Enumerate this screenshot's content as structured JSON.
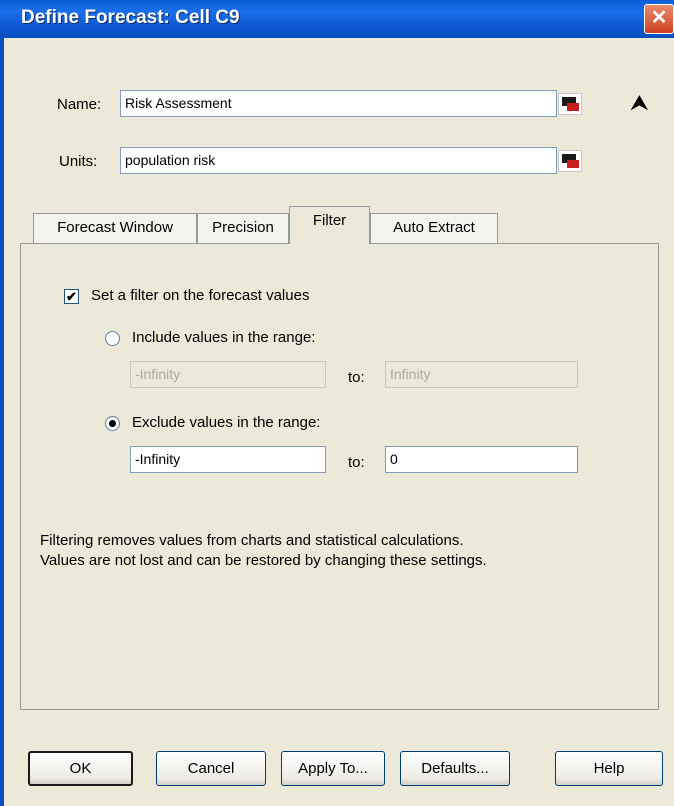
{
  "window": {
    "title": "Define Forecast: Cell C9",
    "close": "✕"
  },
  "name": {
    "label": "Name:",
    "value": "Risk Assessment"
  },
  "units": {
    "label": "Units:",
    "value": "population risk"
  },
  "collapse_icon": "⮝",
  "tabs": [
    {
      "label": "Forecast Window",
      "active": false
    },
    {
      "label": "Precision",
      "active": false
    },
    {
      "label": "Filter",
      "active": true
    },
    {
      "label": "Auto Extract",
      "active": false
    }
  ],
  "filter": {
    "set_filter": {
      "label": "Set a filter on the forecast values",
      "checked": true
    },
    "include": {
      "label": "Include values in the range:",
      "selected": false,
      "from": "-Infinity",
      "to_label": "to:",
      "to": "Infinity"
    },
    "exclude": {
      "label": "Exclude values in the range:",
      "selected": true,
      "from": "-Infinity",
      "to_label": "to:",
      "to": "0"
    },
    "note_line1": "Filtering removes values from charts and statistical calculations.",
    "note_line2": "Values are not lost and can be restored by changing these settings."
  },
  "buttons": {
    "ok": "OK",
    "cancel": "Cancel",
    "apply_to": "Apply To...",
    "defaults": "Defaults...",
    "help": "Help"
  },
  "colors": {
    "titlebar": "#0a5fd6",
    "dialog_bg": "#ece9d8"
  }
}
